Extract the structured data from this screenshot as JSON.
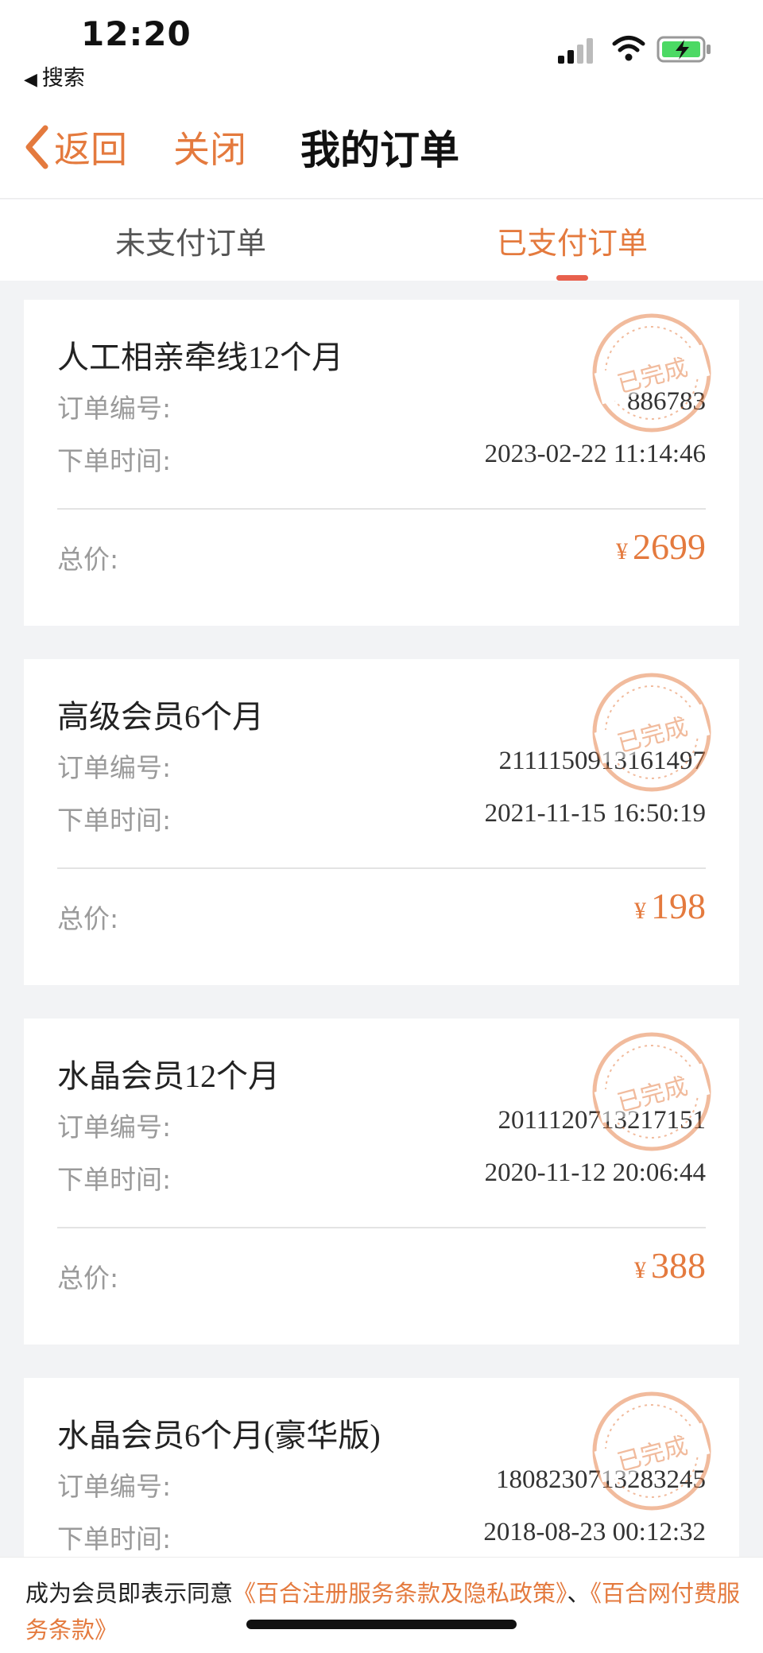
{
  "status_bar": {
    "time": "12:20",
    "back_app_label": "搜索"
  },
  "nav": {
    "back_label": "返回",
    "close_label": "关闭",
    "title": "我的订单"
  },
  "tabs": [
    {
      "label": "未支付订单",
      "active": false
    },
    {
      "label": "已支付订单",
      "active": true
    }
  ],
  "labels": {
    "order_no": "订单编号:",
    "order_time": "下单时间:",
    "total": "总价:",
    "currency": "¥",
    "stamp": "已完成"
  },
  "orders": [
    {
      "name": "人工相亲牵线12个月",
      "order_no": "886783",
      "time": "2023-02-22 11:14:46",
      "price": "2699"
    },
    {
      "name": "高级会员6个月",
      "order_no": "2111150913161497",
      "time": "2021-11-15 16:50:19",
      "price": "198"
    },
    {
      "name": "水晶会员12个月",
      "order_no": "2011120713217151",
      "time": "2020-11-12 20:06:44",
      "price": "388"
    },
    {
      "name": "水晶会员6个月(豪华版)",
      "order_no": "1808230713283245",
      "time": "2018-08-23 00:12:32",
      "price": ""
    }
  ],
  "footer": {
    "prefix": "成为会员即表示同意",
    "link1": "《百合注册服务条款及隐私政策》",
    "separator": "、",
    "link2": "《百合网付费服务条款》"
  },
  "colors": {
    "accent": "#e47a3e",
    "tab_indicator": "#e8604d"
  }
}
